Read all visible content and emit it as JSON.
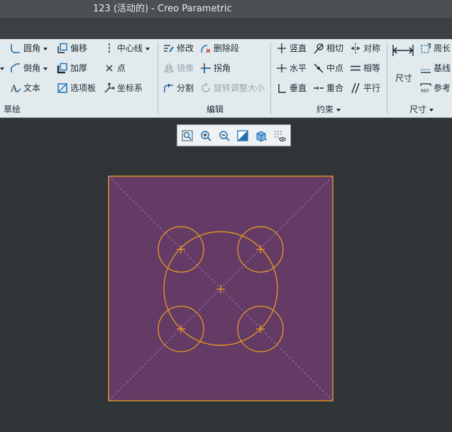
{
  "window": {
    "title": "123 (活动的) - Creo Parametric"
  },
  "ribbon": {
    "sketch": {
      "fillet": "圆角",
      "chamfer": "倒角",
      "text": "文本",
      "offset": "偏移",
      "thicken": "加厚",
      "palette": "选项板",
      "centerline": "中心线",
      "point": "点",
      "coord_sys": "坐标系",
      "group_label": "草绘"
    },
    "edit": {
      "modify": "修改",
      "mirror": "镜像",
      "divide": "分割",
      "delete_segment": "删除段",
      "corner": "拐角",
      "rotate_resize": "旋转调整大小",
      "group_label": "编辑"
    },
    "constraints": {
      "vertical": "竖直",
      "horizontal": "水平",
      "perpendicular": "垂直",
      "tangent": "相切",
      "midpoint": "中点",
      "coincident": "重合",
      "symmetric": "对称",
      "equal": "相等",
      "parallel": "平行",
      "group_label": "约束"
    },
    "dimension": {
      "dimension": "尺寸",
      "perimeter": "周长",
      "baseline": "基线",
      "reference": "参考",
      "ref_badge": "REF",
      "group_label": "尺寸"
    }
  },
  "colors": {
    "sketch_fill": "#643b65",
    "sketch_line": "#f0a020",
    "canvas_bg": "#2f3436",
    "ribbon_bg": "#e3eaee",
    "accent_icon": "#1d6fb3"
  },
  "view_toolbar": {
    "icons": [
      "refit-icon",
      "zoom-in-icon",
      "zoom-out-icon",
      "repaint-icon",
      "display-style-icon",
      "sketch-display-filter-icon"
    ]
  }
}
